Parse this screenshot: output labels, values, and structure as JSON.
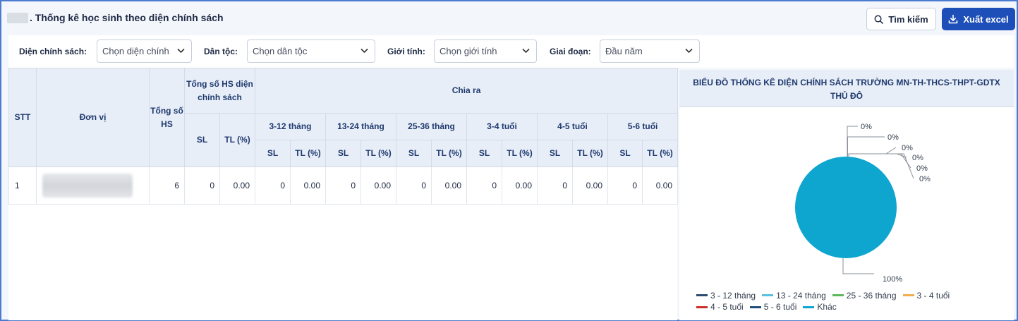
{
  "header": {
    "title": ". Thống kê học sinh theo diện chính sách",
    "search_label": "Tìm kiếm",
    "export_label": "Xuất excel"
  },
  "filters": {
    "policy_label": "Diện chính sách:",
    "policy_value": "Chọn diện chính",
    "ethnic_label": "Dân tộc:",
    "ethnic_value": "Chọn dân tộc",
    "gender_label": "Giới tính:",
    "gender_value": "Chọn giới tính",
    "period_label": "Giai đoạn:",
    "period_value": "Đầu năm"
  },
  "table": {
    "headers": {
      "stt": "STT",
      "unit": "Đơn vị",
      "total": "Tổng số HS",
      "policy_total": "Tổng số HS diện chính sách",
      "breakdown": "Chia ra",
      "sl": "SL",
      "tl": "TL (%)"
    },
    "groups": [
      "3-12 tháng",
      "13-24 tháng",
      "25-36 tháng",
      "3-4 tuổi",
      "4-5 tuổi",
      "5-6 tuổi"
    ],
    "rows": [
      {
        "stt": "1",
        "total": "6",
        "policy_sl": "0",
        "policy_tl": "0.00",
        "cells": [
          {
            "sl": "0",
            "tl": "0.00"
          },
          {
            "sl": "0",
            "tl": "0.00"
          },
          {
            "sl": "0",
            "tl": "0.00"
          },
          {
            "sl": "0",
            "tl": "0.00"
          },
          {
            "sl": "0",
            "tl": "0.00"
          },
          {
            "sl": "0",
            "tl": "0.00"
          }
        ]
      }
    ]
  },
  "chart": {
    "title_line1": "BIỂU ĐỒ THỐNG KÊ DIỆN CHÍNH SÁCH TRƯỜNG MN-TH-THCS-THPT-GDTX",
    "title_line2": "THỦ ĐÔ"
  },
  "chart_data": {
    "type": "pie",
    "title": "BIỂU ĐỒ THỐNG KÊ DIỆN CHÍNH SÁCH TRƯỜNG MN-TH-THCS-THPT-GDTX THỦ ĐÔ",
    "legend_position": "bottom",
    "slices": [
      {
        "name": "3 - 12 tháng",
        "value": 0,
        "label": "0%",
        "color": "#2a4d74"
      },
      {
        "name": "13 - 24 tháng",
        "value": 0,
        "label": "0%",
        "color": "#5bc0de"
      },
      {
        "name": "25 - 36 tháng",
        "value": 0,
        "label": "0%",
        "color": "#5cb85c"
      },
      {
        "name": "3 - 4 tuổi",
        "value": 0,
        "label": "0%",
        "color": "#f0ad4e"
      },
      {
        "name": "4 - 5 tuổi",
        "value": 0,
        "label": "0%",
        "color": "#c9302c"
      },
      {
        "name": "5 - 6 tuổi",
        "value": 0,
        "label": "0%",
        "color": "#1f4e79"
      },
      {
        "name": "Khác",
        "value": 100,
        "label": "100%",
        "color": "#0ea5cf"
      }
    ]
  },
  "colors": {
    "primary": "#1e4fb8",
    "header_bg": "#e8eef8",
    "frame": "#4a7bd0"
  }
}
